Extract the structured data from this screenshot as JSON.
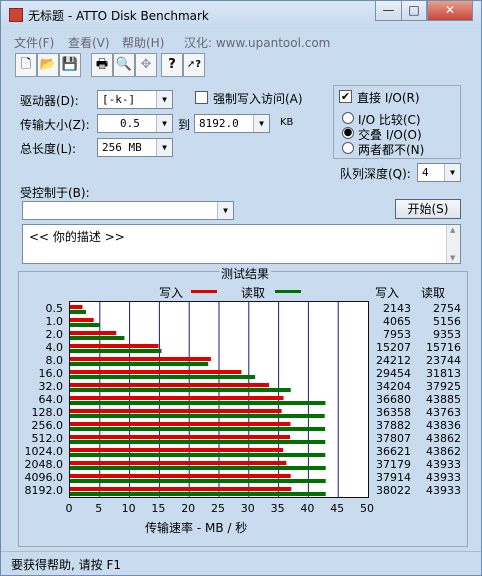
{
  "window": {
    "title": "无标题 - ATTO Disk Benchmark"
  },
  "titlebar_buttons": [
    "—",
    "□",
    "✕"
  ],
  "menu": [
    "文件(F)",
    "查看(V)",
    "帮助(H)",
    "汉化: www.upantool.com"
  ],
  "toolbar_icons": [
    "new-file-icon",
    "open-folder-icon",
    "save-icon",
    "print-icon",
    "print-preview-icon",
    "move-icon",
    "help-question-icon",
    "context-help-icon"
  ],
  "toolbar_glyphs": [
    "🗋",
    "📂",
    "💾",
    "🖶",
    "🔍",
    "✥",
    "?",
    "➚?"
  ],
  "settings": {
    "drive_label": "驱动器(D):",
    "drive_value": "[-k-]",
    "transfer_label": "传输大小(Z):",
    "transfer_from": "0.5",
    "transfer_to_label": "到",
    "transfer_to": "8192.0",
    "transfer_unit": "KB",
    "total_label": "总长度(L):",
    "total_value": "256 MB",
    "force_write_label": "强制写入访问(A)",
    "force_write_checked": false,
    "direct_io_label": "直接 I/O(R)",
    "direct_io_checked": true,
    "io_mode_options": [
      "I/O 比较(C)",
      "交叠 I/O(O)",
      "两者都不(N)"
    ],
    "io_mode_selected": 1,
    "queue_label": "队列深度(Q):",
    "queue_value": "4",
    "controlled_by_label": "受控制于(B):",
    "controlled_by_value": "",
    "start_button": "开始(S)",
    "description": "<<  你的描述  >>"
  },
  "chart_data": {
    "type": "bar",
    "title": "测试结果",
    "legend": [
      "写入",
      "读取"
    ],
    "colors": {
      "write": "#e00000",
      "read": "#007000"
    },
    "categories": [
      "0.5",
      "1.0",
      "2.0",
      "4.0",
      "8.0",
      "16.0",
      "32.0",
      "64.0",
      "128.0",
      "256.0",
      "512.0",
      "1024.0",
      "2048.0",
      "4096.0",
      "8192.0"
    ],
    "series": [
      {
        "name": "写入",
        "values": [
          2143,
          4065,
          7953,
          15207,
          24212,
          29454,
          34204,
          36680,
          36358,
          37882,
          37807,
          36621,
          37179,
          37914,
          38022
        ]
      },
      {
        "name": "读取",
        "values": [
          2754,
          5156,
          9353,
          15716,
          23744,
          31813,
          37925,
          43885,
          43763,
          43836,
          43862,
          43862,
          43933,
          43933,
          43933
        ]
      }
    ],
    "xlabel": "传输速率 - MB / 秒",
    "xticks": [
      "0",
      "5",
      "10",
      "15",
      "20",
      "25",
      "30",
      "35",
      "40",
      "45",
      "50"
    ],
    "xlim": [
      0,
      50
    ],
    "write_header": "写入",
    "read_header": "读取"
  },
  "status": {
    "text": "要获得帮助, 请按 F1"
  }
}
